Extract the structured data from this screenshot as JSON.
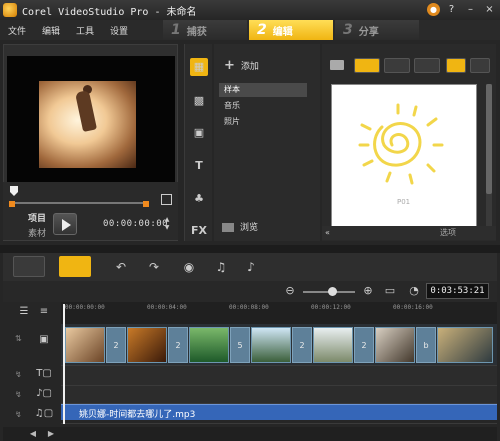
{
  "window": {
    "title": "Corel VideoStudio Pro - 未命名",
    "controls": [
      "●",
      "?",
      "–",
      "×"
    ]
  },
  "menu": [
    "文件",
    "编辑",
    "工具",
    "设置"
  ],
  "steps": [
    {
      "num": "1",
      "label": "捕获",
      "active": false
    },
    {
      "num": "2",
      "label": "编辑",
      "active": true
    },
    {
      "num": "3",
      "label": "分享",
      "active": false
    }
  ],
  "preview": {
    "mode_project": "项目",
    "mode_clip": "素材",
    "timecode": "00:00:00:00"
  },
  "library": {
    "add_label": "添加",
    "categories": [
      "样本",
      "音乐",
      "照片"
    ],
    "selected_category": "样本",
    "browse_label": "浏览",
    "thumbnail_label": "P01",
    "options_label": "选项",
    "side_icons": [
      "media-icon",
      "transition-icon",
      "title-icon",
      "graphic-icon",
      "filter-icon"
    ]
  },
  "timeline": {
    "total_time": "0:03:53:21",
    "ruler": [
      "00:00:00:00",
      "00:00:04:00",
      "00:00:08:00",
      "00:00:12:00",
      "00:00:16:00"
    ],
    "transitions": [
      "2",
      "2",
      "5",
      "2",
      "2",
      "b"
    ],
    "audio_clip": "姚贝娜-时间都去哪儿了.mp3"
  }
}
